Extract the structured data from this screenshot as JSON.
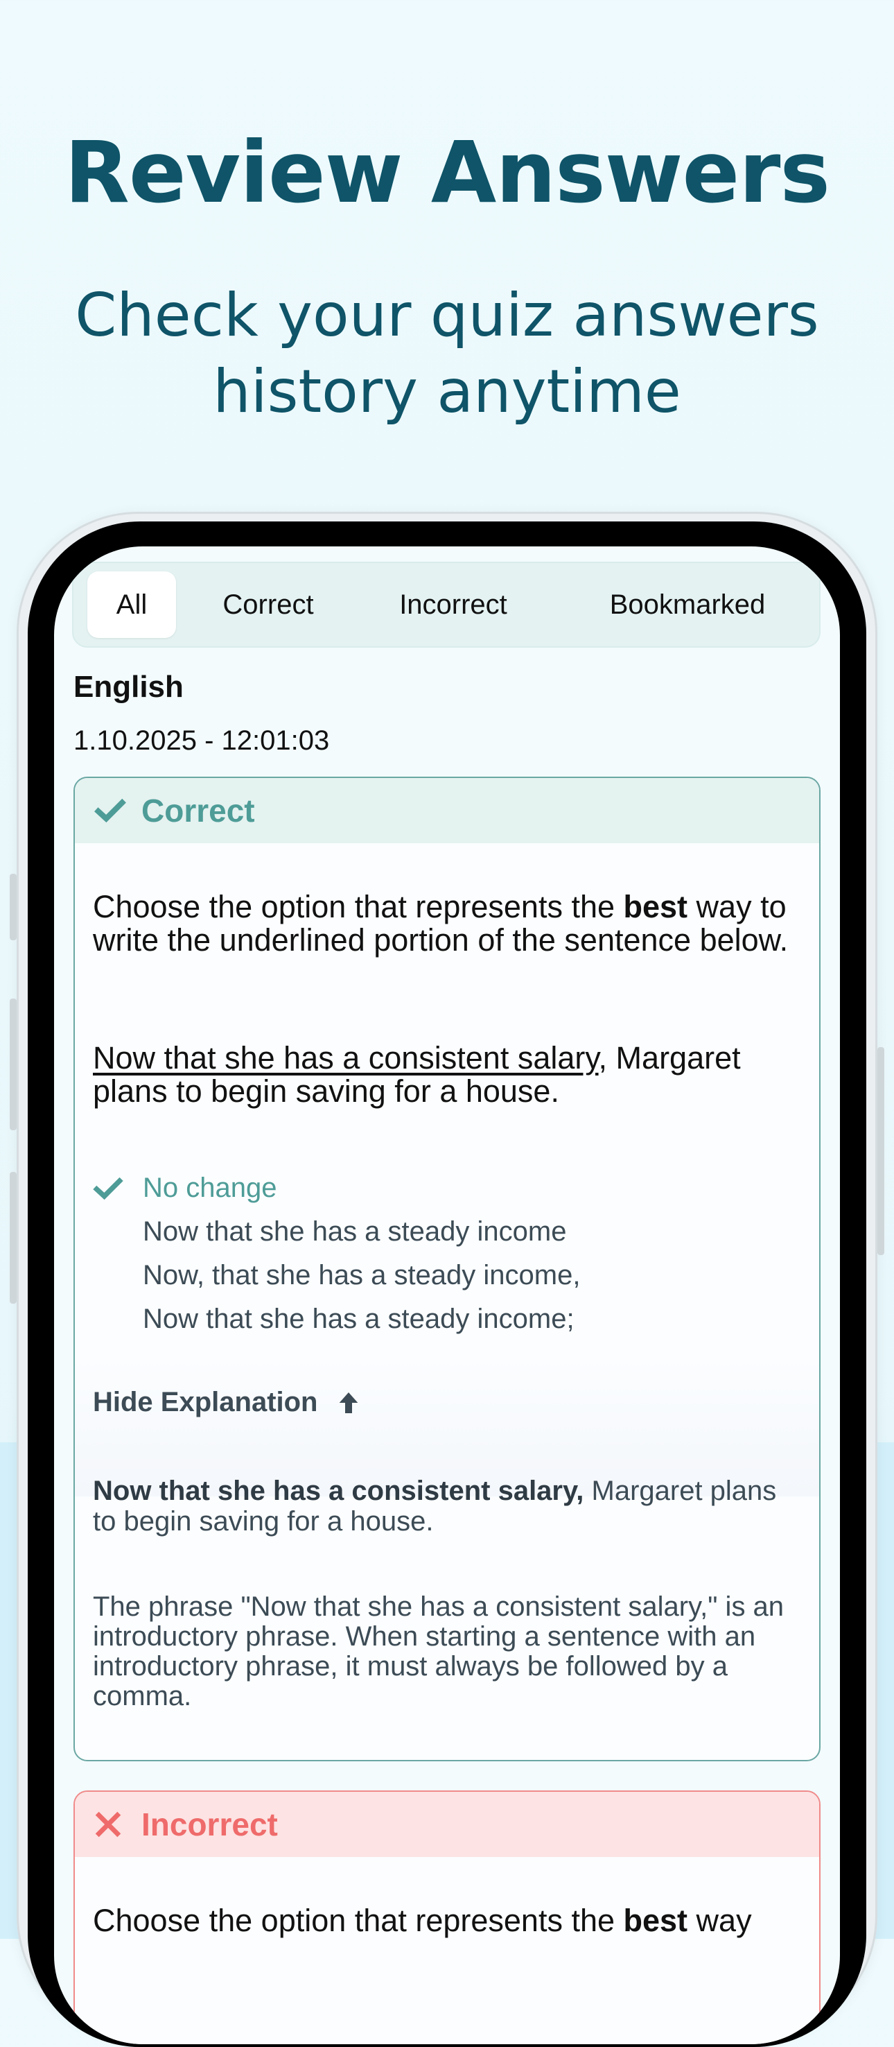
{
  "hero": {
    "title": "Review Answers",
    "subtitle_line1": "Check your quiz answers",
    "subtitle_line2": "history anytime"
  },
  "tabs": [
    {
      "label": "All",
      "active": true
    },
    {
      "label": "Correct",
      "active": false
    },
    {
      "label": "Incorrect",
      "active": false
    },
    {
      "label": "Bookmarked",
      "active": false
    }
  ],
  "quiz": {
    "name": "English",
    "date": "1.10.2025 - 12:01:03"
  },
  "cards": [
    {
      "status": "Correct",
      "status_icon": "check-icon",
      "status_color": "#4e9c97",
      "question_before": "Choose the option that represents the ",
      "question_bold": "best",
      "question_after": " way to write the underlined portion of the sentence below.",
      "sentence_underlined": "Now that she has a consistent salary",
      "sentence_rest": ", Margaret plans to begin saving for a house.",
      "options": [
        {
          "text": "No change",
          "selected": true
        },
        {
          "text": "Now that she has a steady income",
          "selected": false
        },
        {
          "text": "Now, that she has a steady income,",
          "selected": false
        },
        {
          "text": "Now that she has a steady income;",
          "selected": false
        }
      ],
      "explanation_toggle": "Hide Explanation",
      "explanation_sentence_bold": "Now that she has a consistent salary,",
      "explanation_sentence_rest": " Margaret plans to begin saving for a house.",
      "explanation_text": "The phrase \"Now that she has a consistent salary,\" is an introductory phrase. When starting a sentence with an introductory phrase, it must always be followed by a comma."
    },
    {
      "status": "Incorrect",
      "status_icon": "close-icon",
      "status_color": "#ef6b6b",
      "question_before": "Choose the option that represents the ",
      "question_bold": "best",
      "question_after": " way"
    }
  ]
}
